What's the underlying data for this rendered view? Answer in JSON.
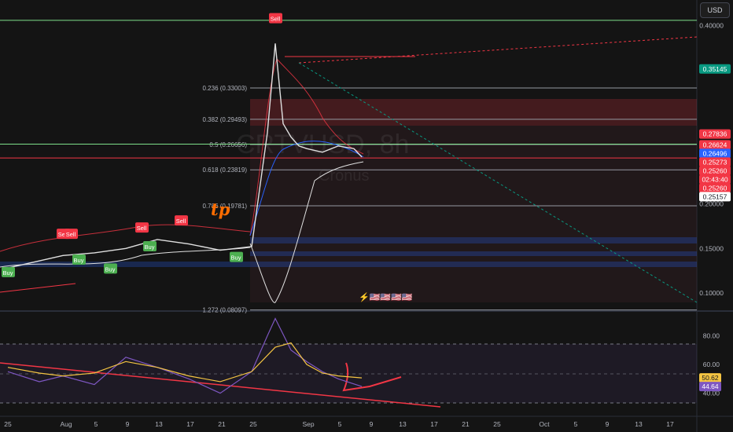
{
  "currency": "USD",
  "watermark": {
    "symbol": "CRTVUSD, 8h",
    "name": "Cronus"
  },
  "logo_text": "tp",
  "chart_data": [
    {
      "type": "line",
      "pane": "price",
      "title": "CRTVUSD, 8h",
      "ylim": [
        0.085,
        0.42
      ],
      "y_ticks": [
        0.4,
        0.2,
        0.15,
        0.1
      ],
      "y_tick_labels": [
        "0.40000",
        "0.20000",
        "0.15000",
        "0.10000"
      ],
      "price_badges": [
        {
          "value": 0.35145,
          "label": "0.35145",
          "color": "#089981"
        },
        {
          "value": 0.27836,
          "label": "0.27836",
          "color": "#f23645"
        },
        {
          "value": 0.26624,
          "label": "0.26624",
          "color": "#f23645"
        },
        {
          "value": 0.26496,
          "label": "0.26496",
          "color": "#2962ff"
        },
        {
          "value": 0.25273,
          "label": "0.25273",
          "color": "#f23645"
        },
        {
          "value": 0.2526,
          "label": "0.25260",
          "color": "#f23645"
        },
        {
          "value": 0.2526,
          "label": "02:43:40",
          "color": "#f23645"
        },
        {
          "value": 0.2526,
          "label": "0.25260",
          "color": "#f23645"
        },
        {
          "value": 0.25157,
          "label": "0.25157",
          "color": "#ffffff"
        }
      ],
      "fib_levels": [
        {
          "label": "0.236 (0.33003)",
          "value": 0.33003
        },
        {
          "label": "0.382 (0.29493)",
          "value": 0.29493
        },
        {
          "label": "0.5 (0.26656)",
          "value": 0.26656
        },
        {
          "label": "0.618 (0.23819)",
          "value": 0.23819
        },
        {
          "label": "0.786 (0.19781)",
          "value": 0.19781
        },
        {
          "label": "1.272 (0.08097)",
          "value": 0.08097
        }
      ],
      "horizontal_lines": [
        {
          "value": 0.406,
          "color": "#7ee08a"
        },
        {
          "value": 0.267,
          "color": "#7ee08a"
        },
        {
          "value": 0.2515,
          "color": "#f23645"
        }
      ],
      "series": [
        {
          "name": "",
          "color": "#e0e0e0",
          "x": [
            "Jul 25",
            "Aug 1",
            "Aug 5",
            "Aug 9",
            "Aug 13",
            "Aug 17",
            "Aug 21",
            "Aug 25",
            "Aug 27",
            "Aug 28",
            "Aug 29",
            "Aug 30",
            "Aug 31",
            "Sep 1",
            "Sep 3",
            "Sep 5",
            "Sep 7",
            "Sep 8"
          ],
          "y": [
            0.128,
            0.142,
            0.145,
            0.15,
            0.16,
            0.155,
            0.148,
            0.152,
            0.28,
            0.38,
            0.29,
            0.275,
            0.265,
            0.262,
            0.258,
            0.265,
            0.262,
            0.2526
          ]
        }
      ],
      "signals": [
        {
          "label": "Sell",
          "x": "Aug 1",
          "y": 0.166
        },
        {
          "label": "Sell",
          "x": "Aug 2",
          "y": 0.166
        },
        {
          "label": "Buy",
          "x": "Jul 25",
          "y": 0.123
        },
        {
          "label": "Buy",
          "x": "Aug 3",
          "y": 0.137
        },
        {
          "label": "Buy",
          "x": "Aug 7",
          "y": 0.127
        },
        {
          "label": "Buy",
          "x": "Aug 12",
          "y": 0.152
        },
        {
          "label": "Sell",
          "x": "Aug 11",
          "y": 0.173
        },
        {
          "label": "Sell",
          "x": "Aug 16",
          "y": 0.181
        },
        {
          "label": "Buy",
          "x": "Aug 23",
          "y": 0.14
        },
        {
          "label": "Sell",
          "x": "Aug 28",
          "y": 0.408
        }
      ],
      "events_row": "⚡🇺🇸🇺🇸🇺🇸🇺🇸"
    },
    {
      "type": "line",
      "pane": "rsi",
      "ylim": [
        25,
        95
      ],
      "y_ticks": [
        80,
        60,
        40
      ],
      "y_tick_labels": [
        "80.00",
        "60.00",
        "40.00"
      ],
      "badges": [
        {
          "value": 50.62,
          "label": "50.62",
          "color": "#f5c542"
        },
        {
          "value": 44.64,
          "label": "44.64",
          "color": "#7e57c2"
        }
      ],
      "series": [
        {
          "name": "",
          "color": "#7e57c2",
          "x": [
            "Jul 25",
            "Jul 29",
            "Aug 1",
            "Aug 5",
            "Aug 9",
            "Aug 13",
            "Aug 17",
            "Aug 21",
            "Aug 25",
            "Aug 27",
            "Aug 28",
            "Aug 30",
            "Sep 1",
            "Sep 3",
            "Sep 5",
            "Sep 8"
          ],
          "y": [
            55,
            48,
            52,
            46,
            65,
            58,
            50,
            40,
            55,
            80,
            92,
            70,
            62,
            55,
            50,
            44.64
          ]
        },
        {
          "name": "",
          "color": "#f5c542",
          "x": [
            "Jul 25",
            "Jul 29",
            "Aug 1",
            "Aug 5",
            "Aug 9",
            "Aug 13",
            "Aug 17",
            "Aug 21",
            "Aug 25",
            "Aug 28",
            "Aug 30",
            "Sep 1",
            "Sep 3",
            "Sep 5",
            "Sep 8"
          ],
          "y": [
            58,
            54,
            52,
            54,
            62,
            58,
            52,
            48,
            55,
            72,
            75,
            60,
            54,
            52,
            50.62
          ]
        }
      ]
    }
  ],
  "x_axis": {
    "ticks": [
      "25",
      "Aug",
      "5",
      "9",
      "13",
      "17",
      "21",
      "25",
      "Sep",
      "5",
      "9",
      "13",
      "17",
      "21",
      "25",
      "Oct",
      "5",
      "9",
      "13",
      "17"
    ]
  }
}
